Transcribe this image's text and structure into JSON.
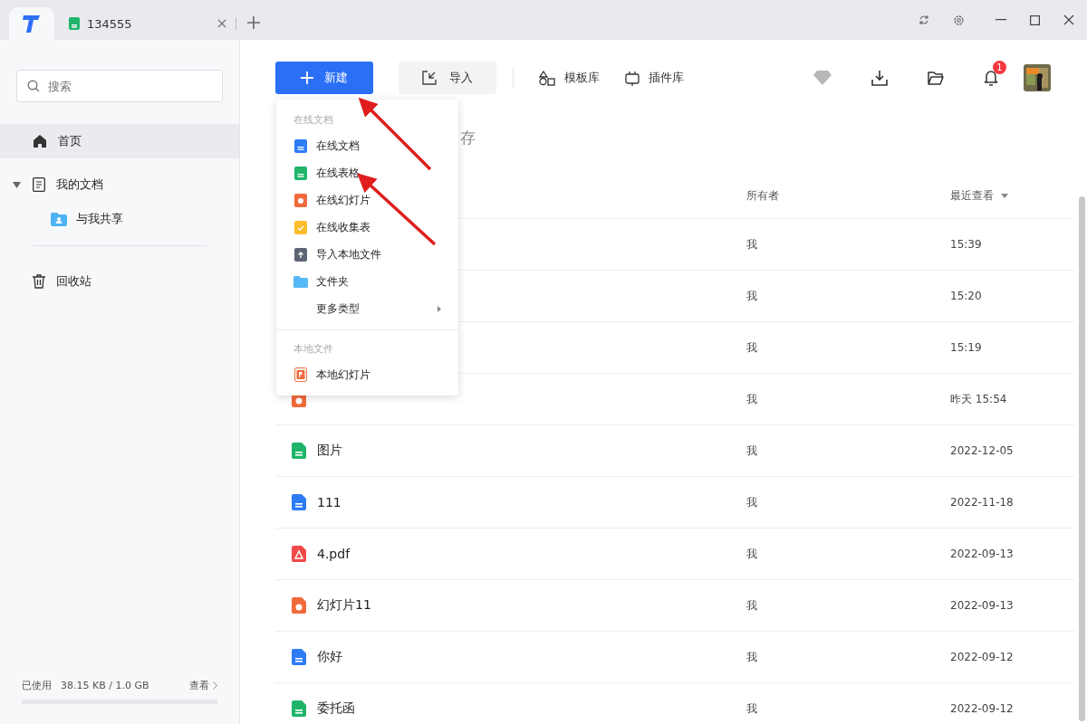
{
  "titlebar": {
    "tabs": [
      {
        "kind": "sheet",
        "label": "134555"
      }
    ]
  },
  "sidebar": {
    "search": {
      "placeholder": "搜索"
    },
    "items": [
      {
        "kind": "home",
        "label": "首页",
        "selected": true
      },
      {
        "kind": "docs",
        "label": "我的文档",
        "selected": false,
        "expanded": true,
        "children": [
          {
            "kind": "shared",
            "label": "与我共享",
            "selected": false
          }
        ]
      },
      {
        "kind": "trash",
        "label": "回收站",
        "selected": false
      }
    ],
    "storage": {
      "label": "已使用",
      "value": "38.15 KB / 1.0 GB",
      "link": "查看"
    }
  },
  "toolbar": {
    "new_button": "新建",
    "import_button": "导入",
    "links": [
      {
        "kind": "template",
        "label": "模板库"
      },
      {
        "kind": "plugin",
        "label": "插件库"
      }
    ],
    "notification_count": "1"
  },
  "heading_fragment": "存",
  "table": {
    "columns": [
      {
        "label": "所有者",
        "sorted": false
      },
      {
        "label": "最近查看",
        "sorted": true
      }
    ],
    "rows": [
      {
        "owner": "我",
        "time": "15:39"
      },
      {
        "owner": "我",
        "time": "15:20"
      },
      {
        "owner": "我",
        "time": "15:19"
      },
      {
        "kind": "slides",
        "owner": "我",
        "time": "昨天 15:54"
      },
      {
        "kind": "sheet",
        "name": "图片",
        "owner": "我",
        "time": "2022-12-05"
      },
      {
        "kind": "doc",
        "name": "111",
        "owner": "我",
        "time": "2022-11-18"
      },
      {
        "kind": "pdf",
        "name": "4.pdf",
        "owner": "我",
        "time": "2022-09-13"
      },
      {
        "kind": "slides",
        "name": "幻灯片11",
        "owner": "我",
        "time": "2022-09-13"
      },
      {
        "kind": "doc",
        "name": "你好",
        "owner": "我",
        "time": "2022-09-12"
      },
      {
        "kind": "sheet",
        "name": "委托函",
        "owner": "我",
        "time": "2022-09-12"
      }
    ]
  },
  "new_menu": {
    "sections": [
      {
        "title": "在线文档",
        "items": [
          {
            "kind": "doc",
            "label": "在线文档"
          },
          {
            "kind": "sheet",
            "label": "在线表格"
          },
          {
            "kind": "slides",
            "label": "在线幻灯片"
          },
          {
            "kind": "form",
            "label": "在线收集表"
          },
          {
            "kind": "upload",
            "label": "导入本地文件"
          },
          {
            "kind": "folder",
            "label": "文件夹"
          },
          {
            "kind": "more",
            "label": "更多类型"
          }
        ]
      },
      {
        "title": "本地文件",
        "items": [
          {
            "kind": "ppt",
            "label": "本地幻灯片"
          }
        ]
      }
    ]
  }
}
